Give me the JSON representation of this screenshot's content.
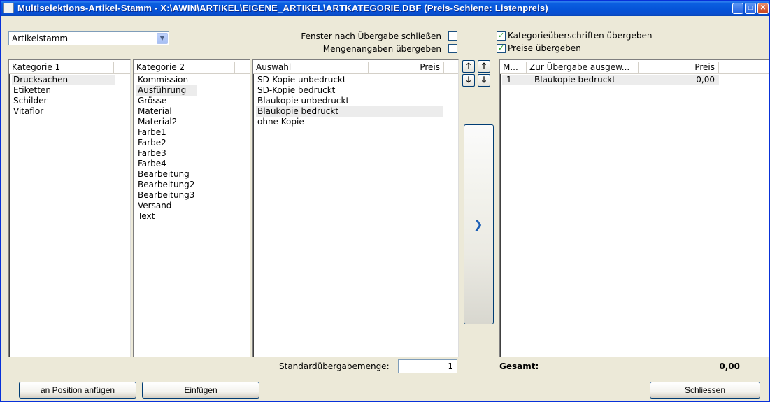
{
  "window": {
    "title": "Multiselektions-Artikel-Stamm - X:\\AWIN\\ARTIKEL\\EIGENE_ARTIKEL\\ARTKATEGORIE.DBF (Preis-Schiene: Listenpreis)"
  },
  "combo": {
    "value": "Artikelstamm"
  },
  "options": {
    "close_after": {
      "label": "Fenster nach Übergabe schließen",
      "checked": false
    },
    "quantities": {
      "label": "Mengenangaben übergeben",
      "checked": false
    },
    "category_headers": {
      "label": "Kategorieüberschriften übergeben",
      "checked": true
    },
    "prices": {
      "label": "Preise übergeben",
      "checked": true
    }
  },
  "kategorie1": {
    "header": "Kategorie 1",
    "items": [
      "Drucksachen",
      "Etiketten",
      "Schilder",
      "Vitaflor"
    ]
  },
  "kategorie2": {
    "header": "Kategorie 2",
    "items": [
      "Kommission",
      "Ausführung",
      "Grösse",
      "Material",
      "Material2",
      "Farbe1",
      "Farbe2",
      "Farbe3",
      "Farbe4",
      "Bearbeitung",
      "Bearbeitung2",
      "Bearbeitung3",
      "Versand",
      "Text"
    ]
  },
  "auswahl": {
    "header": "Auswahl",
    "price_header": "Preis",
    "items": [
      "SD-Kopie unbedruckt",
      "SD-Kopie bedruckt",
      "Blaukopie unbedruckt",
      "Blaukopie bedruckt",
      "ohne Kopie"
    ]
  },
  "transfer_list": {
    "col_m": "M...",
    "col_name": "Zur Übergabe ausgew...",
    "col_price": "Preis",
    "rows": [
      {
        "m": "1",
        "name": "Blaukopie bedruckt",
        "price": "0,00"
      }
    ]
  },
  "footer": {
    "default_qty_label": "Standardübergabemenge:",
    "default_qty_value": "1",
    "total_label": "Gesamt:",
    "total_value": "0,00"
  },
  "buttons": {
    "append_at_position": "an Position anfügen",
    "insert": "Einfügen",
    "close": "Schliessen"
  }
}
